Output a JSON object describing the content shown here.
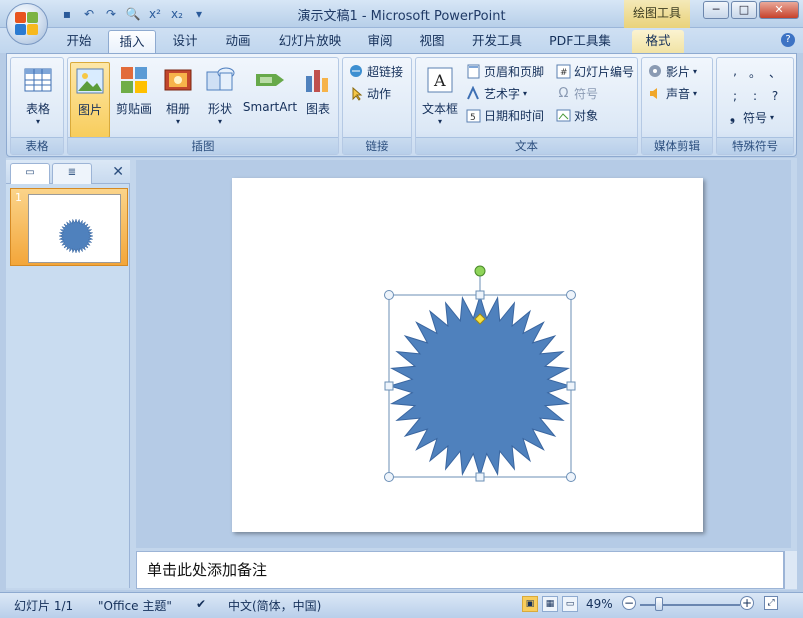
{
  "window": {
    "title": "演示文稿1 - Microsoft PowerPoint",
    "context_tab_title": "绘图工具",
    "min": "─",
    "max": "□",
    "close": "✕"
  },
  "tabs": [
    "开始",
    "插入",
    "设计",
    "动画",
    "幻灯片放映",
    "审阅",
    "视图",
    "开发工具",
    "PDF工具集",
    "格式"
  ],
  "active_tab": "插入",
  "ribbon": {
    "groups": {
      "table": "表格",
      "illustrations": "插图",
      "links": "链接",
      "text": "文本",
      "media": "媒体剪辑",
      "symbols": "特殊符号"
    },
    "buttons": {
      "table": "表格",
      "picture": "图片",
      "clipart": "剪贴画",
      "album": "相册",
      "shapes": "形状",
      "smartart": "SmartArt",
      "chart": "图表",
      "hyperlink": "超链接",
      "action": "动作",
      "textbox": "文本框",
      "header_footer": "页眉和页脚",
      "wordart": "艺术字",
      "datetime": "日期和时间",
      "slide_number": "幻灯片编号",
      "symbol": "符号",
      "object": "对象",
      "movie": "影片",
      "sound": "声音",
      "special_symbol": "符号"
    },
    "symbol_chars": [
      ",",
      "。",
      "、",
      ";",
      ":",
      "?"
    ]
  },
  "slides_pane": {
    "slide_number": "1"
  },
  "notes_placeholder": "单击此处添加备注",
  "status": {
    "slide": "幻灯片 1/1",
    "theme": "\"Office 主题\"",
    "language": "中文(简体，中国)",
    "zoom": "49%"
  },
  "shape": {
    "type": "starburst",
    "points": 32,
    "fill": "#4f81bd",
    "stroke": "#3a66a0"
  }
}
